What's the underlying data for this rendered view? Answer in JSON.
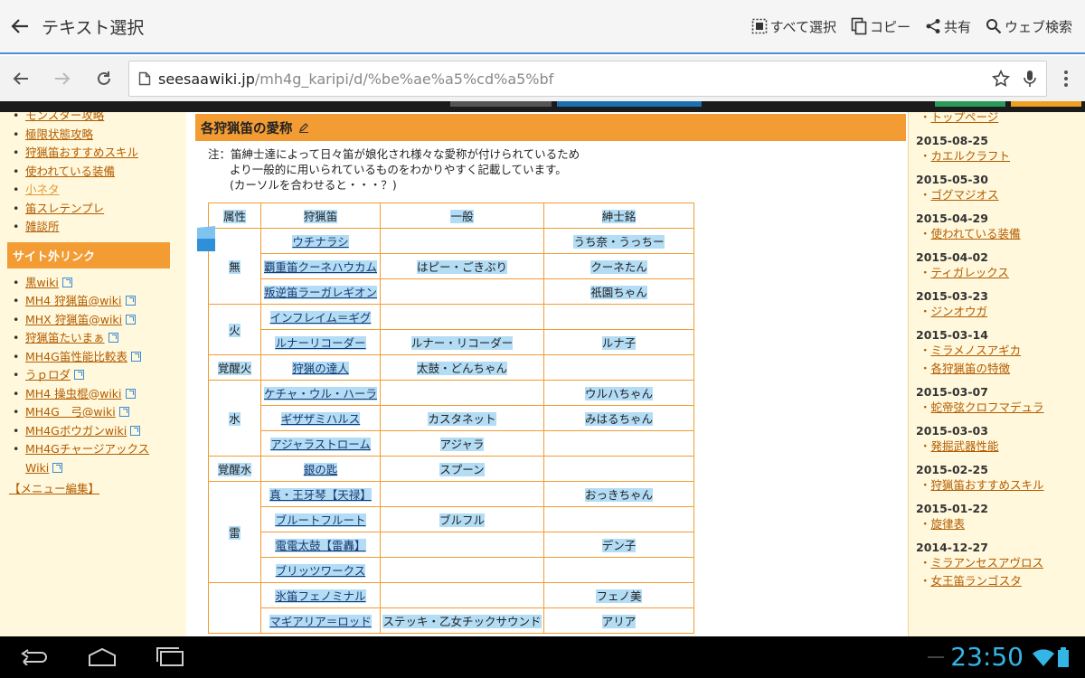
{
  "action_bar": {
    "title": "テキスト選択",
    "select_all": "すべて選択",
    "copy": "コピー",
    "share": "共有",
    "web_search": "ウェブ検索"
  },
  "browser": {
    "url_domain": "seesaawiki.jp",
    "url_path": "/mh4g_karipi/d/%be%ae%a5%cd%a5%bf"
  },
  "left_sidebar": {
    "items_top": [
      "モンスター攻略",
      "極限状態攻略",
      "狩猟笛おすすめスキル",
      "使われている装備",
      "小ネタ",
      "笛スレテンプレ",
      "雑談所"
    ],
    "external_header": "サイト外リンク",
    "external_links": [
      "黒wiki",
      "MH4 狩猟笛@wiki",
      "MHX 狩猟笛@wiki",
      "狩猟笛たいまぁ",
      "MH4G笛性能比較表",
      "うｐロダ",
      "MH4 操虫棍@wiki",
      "MH4G　弓@wiki",
      "MH4Gボウガンwiki",
      "MH4Gチャージアックス Wiki"
    ],
    "menu_edit": "【メニュー編集】"
  },
  "main": {
    "heading": "各狩猟笛の愛称",
    "note_1": "注：笛紳士達によって日々笛が娘化され様々な愛称が付けられているため",
    "note_2": "より一般的に用いられているものをわかりやすく記載しています。",
    "note_3": "(カーソルを合わせると・・・？)",
    "table": {
      "headers": [
        "属性",
        "狩猟笛",
        "一般",
        "紳士銘"
      ],
      "groups": [
        {
          "attr": "無",
          "rows": [
            {
              "weapon": "ウチナラシ",
              "general": "",
              "gentleman": "うち奈・うっちー"
            },
            {
              "weapon": "覇重笛クーネハウカム",
              "general": "はピー・ごきぶり",
              "gentleman": "クーネたん"
            },
            {
              "weapon": "叛逆笛ラーガレギオン",
              "general": "",
              "gentleman": "祇園ちゃん"
            }
          ]
        },
        {
          "attr": "火",
          "rows": [
            {
              "weapon": "インフレイム＝ギグ",
              "general": "",
              "gentleman": ""
            },
            {
              "weapon": "ルナーリコーダー",
              "general": "ルナー・リコーダー",
              "gentleman": "ルナ子"
            }
          ]
        },
        {
          "attr": "覚醒火",
          "rows": [
            {
              "weapon": "狩猟の達人",
              "general": "太鼓・どんちゃん",
              "gentleman": ""
            }
          ]
        },
        {
          "attr": "水",
          "rows": [
            {
              "weapon": "ケチャ・ウル・ハーラ",
              "general": "",
              "gentleman": "ウルハちゃん"
            },
            {
              "weapon": "ギザザミハルス",
              "general": "カスタネット",
              "gentleman": "みはるちゃん"
            },
            {
              "weapon": "アジャラストローム",
              "general": "アジャラ",
              "gentleman": ""
            }
          ]
        },
        {
          "attr": "覚醒水",
          "rows": [
            {
              "weapon": "銀の匙",
              "general": "スプーン",
              "gentleman": ""
            }
          ]
        },
        {
          "attr": "雷",
          "rows": [
            {
              "weapon": "真・王牙琴【天禄】",
              "general": "",
              "gentleman": "おっきちゃん"
            },
            {
              "weapon": "ブルートフルート",
              "general": "ブルフル",
              "gentleman": ""
            },
            {
              "weapon": "電電太鼓【雷轟】",
              "general": "",
              "gentleman": "デン子"
            },
            {
              "weapon": "ブリッツワークス",
              "general": "",
              "gentleman": ""
            }
          ]
        },
        {
          "attr": "",
          "rows": [
            {
              "weapon": "氷笛フェノミナル",
              "general": "",
              "gentleman": "フェノ美"
            },
            {
              "weapon": "マギアリア＝ロッド",
              "general": "ステッキ・乙女チックサウンド",
              "gentleman": "アリア"
            }
          ]
        }
      ]
    }
  },
  "right_sidebar": {
    "top_link": "トップページ",
    "updates": [
      {
        "date": "2015-08-25",
        "links": [
          "カエルクラフト"
        ]
      },
      {
        "date": "2015-05-30",
        "links": [
          "ゴグマジオス"
        ]
      },
      {
        "date": "2015-04-29",
        "links": [
          "使われている装備"
        ]
      },
      {
        "date": "2015-04-02",
        "links": [
          "ティガレックス"
        ]
      },
      {
        "date": "2015-03-23",
        "links": [
          "ジンオウガ"
        ]
      },
      {
        "date": "2015-03-14",
        "links": [
          "ミラメノスアギカ",
          "各狩猟笛の特徴"
        ]
      },
      {
        "date": "2015-03-07",
        "links": [
          "蛇帝弦クロフマデュラ"
        ]
      },
      {
        "date": "2015-03-03",
        "links": [
          "発掘武器性能"
        ]
      },
      {
        "date": "2015-02-25",
        "links": [
          "狩猟笛おすすめスキル"
        ]
      },
      {
        "date": "2015-01-22",
        "links": [
          "旋律表"
        ]
      },
      {
        "date": "2014-12-27",
        "links": [
          "ミラアンセスアヴロス",
          "女王笛ランゴスタ"
        ]
      }
    ]
  },
  "system_bar": {
    "time": "23:50"
  },
  "colors": {
    "accent_orange": "#f39c33",
    "selection_blue": "#b3dcf5",
    "clock_blue": "#33b5e5"
  }
}
